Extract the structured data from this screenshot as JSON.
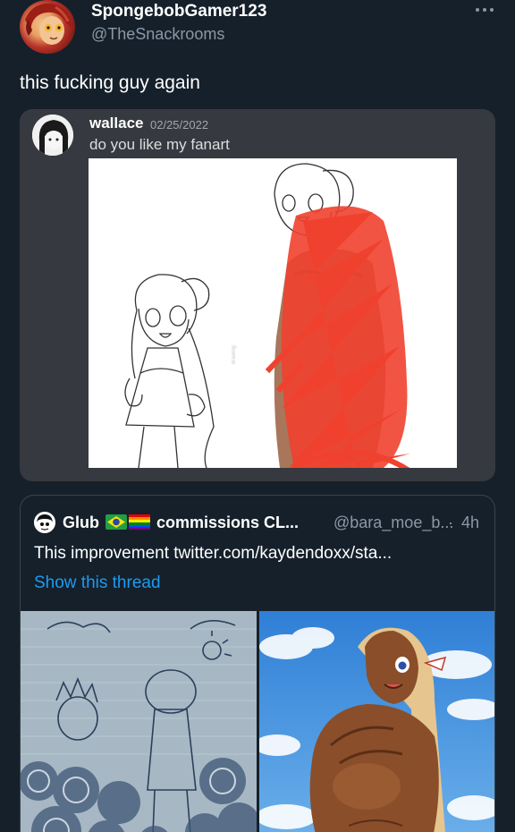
{
  "tweet": {
    "display_name": "SpongebobGamer123",
    "handle": "@TheSnackrooms",
    "text": "this fucking guy again",
    "more_icon": "more-horizontal-icon"
  },
  "discord": {
    "username": "wallace",
    "date": "02/25/2022",
    "message": "do you like my fanart"
  },
  "quote": {
    "name_part1": "Glub",
    "flags": [
      "brazil-flag-icon",
      "pride-flag-icon"
    ],
    "name_part2": "commissions CL...",
    "handle": "@bara_moe_b...",
    "separator": "·",
    "time": "4h",
    "text": "This improvement  twitter.com/kaydendoxx/sta...",
    "show_thread": "Show this thread"
  },
  "colors": {
    "background": "#15202b",
    "secondary_text": "#8b98a5",
    "link": "#1d9bf0",
    "discord_bg": "#36393f",
    "border": "#38444d",
    "scribble_red": "#f0412f"
  }
}
